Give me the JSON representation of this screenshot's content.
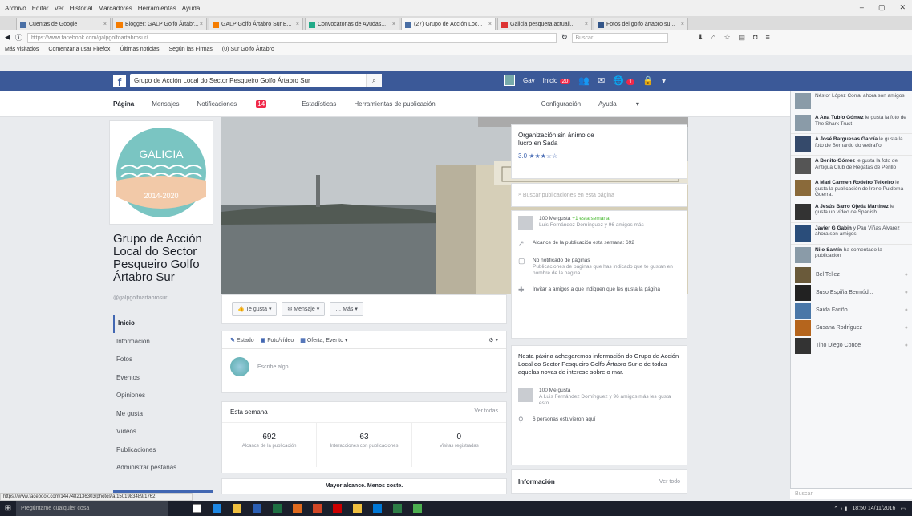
{
  "browser": {
    "menu": [
      "Archivo",
      "Editar",
      "Ver",
      "Historial",
      "Marcadores",
      "Herramientas",
      "Ayuda"
    ],
    "tabs": [
      {
        "label": "Cuentas de Google"
      },
      {
        "label": "Blogger: GALP Golfo Ártabr..."
      },
      {
        "label": "GALP Golfo Ártabro Sur E..."
      },
      {
        "label": "Convocatorias de Ayudas..."
      },
      {
        "label": "(27) Grupo de Acción Loc...",
        "active": true
      },
      {
        "label": "Galicia pesquera actuali..."
      },
      {
        "label": "Fotos del golfo ártabro su..."
      }
    ],
    "url": "https://www.facebook.com/galpgolfoartabrosur/",
    "search_placeholder": "Buscar",
    "bookmarks": [
      "Más visitados",
      "Comenzar a usar Firefox",
      "Últimas noticias",
      "Según las Firmas",
      "(0) Sur Golfo Ártabro"
    ],
    "status_url": "https://www.facebook.com/1447482136303/photos/a.1501983489/1762"
  },
  "fb": {
    "search_value": "Grupo de Acción Local do Sector Pesqueiro Golfo Ártabro Sur",
    "user_name": "Gav",
    "home_label": "Inicio",
    "home_count": "20",
    "notif_count": "1"
  },
  "pagenav": {
    "page": "Página",
    "messages": "Mensajes",
    "notifications": "Notificaciones",
    "notifications_count": "14",
    "stats": "Estadísticas",
    "tools": "Herramientas de publicación",
    "settings": "Configuración",
    "help": "Ayuda"
  },
  "profile": {
    "logo_text": "GALICIA",
    "logo_years": "2014-2020",
    "name": "Grupo de Acción Local do Sector Pesqueiro Golfo Ártabro Sur",
    "username": "@galpgolfoartabrosur"
  },
  "leftnav": [
    "Inicio",
    "Información",
    "Fotos",
    "Eventos",
    "Opiniones",
    "Me gusta",
    "Vídeos",
    "Publicaciones",
    "Administrar pestañas"
  ],
  "actions": {
    "like": "Te gusta",
    "message": "Mensaje",
    "more": "Más"
  },
  "composer": {
    "status": "Estado",
    "photo": "Foto/vídeo",
    "offer": "Oferta, Evento",
    "placeholder": "Escribe algo..."
  },
  "week": {
    "title": "Esta semana",
    "see_all": "Ver todas",
    "stats": [
      {
        "value": "692",
        "label": "Alcance de la publicación"
      },
      {
        "value": "63",
        "label": "Interacciones con publicaciones"
      },
      {
        "value": "0",
        "label": "Visitas registradas"
      }
    ],
    "bottom": "Mayor alcance. Menos coste."
  },
  "right": {
    "org_type": "Organización sin ánimo de lucro en Sada",
    "rating": "3.0",
    "stars": 3,
    "page_search": "Buscar publicaciones en esta página",
    "likes_summary": "100 Me gusta",
    "likes_new": "+1 esta semana",
    "likes_sub": "Luis Fernández Domínguez y 96 amigos más",
    "reach": "Alcance de la publicación esta semana: 692",
    "notif_pages": "No notificado de páginas",
    "pages_desc": "Publicaciones de páginas que has indicado que te gustan en nombre de la página",
    "invite": "Invitar a amigos a que indiquen que les gusta la página",
    "about": "Nesta páxina achegaremos información do Grupo de Acción Local do Sector Pesqueiro Golfo Ártabro Sur e de todas aquelas novas de interese sobre o mar.",
    "likes2": "100 Me gusta",
    "likes2_sub": "A Luis Fernández Domínguez y 96 amigos más les gusta esto",
    "visits": "6 personas estuvieron aquí",
    "info_title": "Información",
    "info_link": "Ver todo"
  },
  "ticker": [
    {
      "name": "",
      "text": "Néstor López Corral ahora son amigos"
    },
    {
      "name": "A Ana Tubío Gómez",
      "text": "le gusta la foto de The Shark Trust"
    },
    {
      "name": "A José Barguesas García",
      "text": "le gusta la foto de Bernardo do vedraño."
    },
    {
      "name": "A Benito Gómez",
      "text": "le gusta la foto de Antigua Club de Regatas de Perillo"
    },
    {
      "name": "A Mari Carmen Rodeiro Teixeiro",
      "text": "le gusta la publicación de Irene Puldema Guerra."
    },
    {
      "name": "A Jesús Barro Ojeda Martínez",
      "text": "le gusta un vídeo de Spanish."
    },
    {
      "name": "Javier G Gabin",
      "text": "y Pau Viñas Álvarez ahora son amigos"
    },
    {
      "name": "Nilo Santín",
      "text": "ha comentado la publicación"
    }
  ],
  "chat": [
    "Bel Tellez",
    "Suso Espiña Bermúd...",
    "Saida Fariño",
    "Susana Rodríguez",
    "Tino Diego Conde"
  ],
  "chat_search": "Buscar",
  "taskbar": {
    "search": "Pregúntame cualquier cosa",
    "time": "18:50",
    "date": "14/11/2016"
  }
}
